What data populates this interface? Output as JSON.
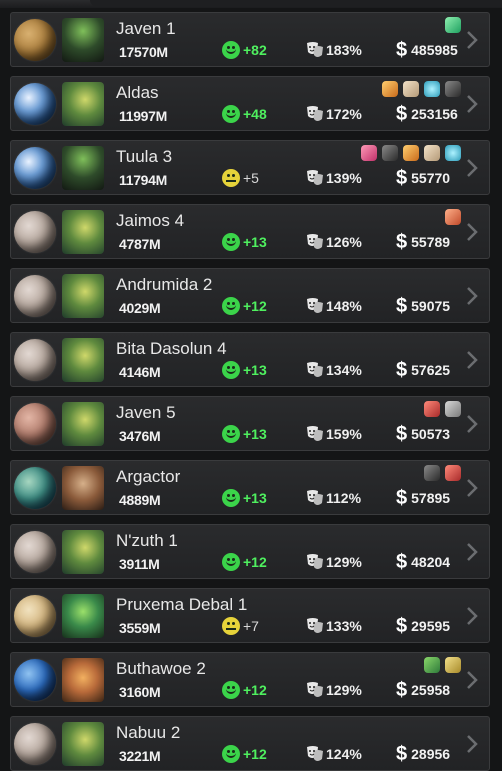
{
  "colors": {
    "happy_green": "#3bd44a",
    "neutral_yellow": "#e6d33a",
    "positive_text": "#4ff05f",
    "neutral_text": "#d8d8d8"
  },
  "rows": [
    {
      "name": "Javen 1",
      "pop": "17570M",
      "mood": "happy",
      "happiness": "+82",
      "stability": "183%",
      "credits": "485985",
      "planet": "desert",
      "species": "green-insectoid",
      "resources": [
        "green-gem-icon"
      ]
    },
    {
      "name": "Aldas",
      "pop": "11997M",
      "mood": "happy",
      "happiness": "+48",
      "stability": "172%",
      "credits": "253156",
      "planet": "earth",
      "species": "green-reptile",
      "resources": [
        "orange-crystal-icon",
        "ore-icon",
        "cyan-spheres-icon",
        "dark-artifact-icon"
      ]
    },
    {
      "name": "Tuula 3",
      "pop": "11794M",
      "mood": "neutral",
      "happiness": "+5",
      "stability": "139%",
      "credits": "55770",
      "planet": "earth",
      "species": "green-insectoid",
      "resources": [
        "pink-potion-icon",
        "dark-artifact-icon",
        "orange-crystal-icon",
        "ore-icon",
        "cyan-spheres-icon"
      ]
    },
    {
      "name": "Jaimos 4",
      "pop": "4787M",
      "mood": "happy",
      "happiness": "+13",
      "stability": "126%",
      "credits": "55789",
      "planet": "barren",
      "species": "green-reptile",
      "resources": [
        "red-bar-icon"
      ]
    },
    {
      "name": "Andrumida 2",
      "pop": "4029M",
      "mood": "happy",
      "happiness": "+12",
      "stability": "148%",
      "credits": "59075",
      "planet": "barren",
      "species": "green-reptile",
      "resources": []
    },
    {
      "name": "Bita Dasolun 4",
      "pop": "4146M",
      "mood": "happy",
      "happiness": "+13",
      "stability": "134%",
      "credits": "57625",
      "planet": "barren",
      "species": "green-reptile",
      "resources": []
    },
    {
      "name": "Javen 5",
      "pop": "3476M",
      "mood": "happy",
      "happiness": "+13",
      "stability": "159%",
      "credits": "50573",
      "planet": "red-barren",
      "species": "green-reptile",
      "resources": [
        "red-crystal-icon",
        "grey-ore-icon"
      ]
    },
    {
      "name": "Argactor",
      "pop": "4889M",
      "mood": "happy",
      "happiness": "+13",
      "stability": "112%",
      "credits": "57895",
      "planet": "ocean-green",
      "species": "brown-creature",
      "resources": [
        "dark-artifact-icon",
        "red-crystal-icon"
      ]
    },
    {
      "name": "N'zuth 1",
      "pop": "3911M",
      "mood": "happy",
      "happiness": "+12",
      "stability": "129%",
      "credits": "48204",
      "planet": "barren",
      "species": "green-reptile",
      "resources": []
    },
    {
      "name": "Pruxema Debal 1",
      "pop": "3559M",
      "mood": "neutral",
      "happiness": "+7",
      "stability": "133%",
      "credits": "29595",
      "planet": "tan",
      "species": "green-alien",
      "resources": []
    },
    {
      "name": "Buthawoe 2",
      "pop": "3160M",
      "mood": "happy",
      "happiness": "+12",
      "stability": "129%",
      "credits": "25958",
      "planet": "blue-ocean",
      "species": "orange-frog",
      "resources": [
        "green-plant-icon",
        "yellow-crate-icon"
      ]
    },
    {
      "name": "Nabuu 2",
      "pop": "3221M",
      "mood": "happy",
      "happiness": "+12",
      "stability": "124%",
      "credits": "28956",
      "planet": "barren",
      "species": "green-reptile",
      "resources": []
    }
  ]
}
